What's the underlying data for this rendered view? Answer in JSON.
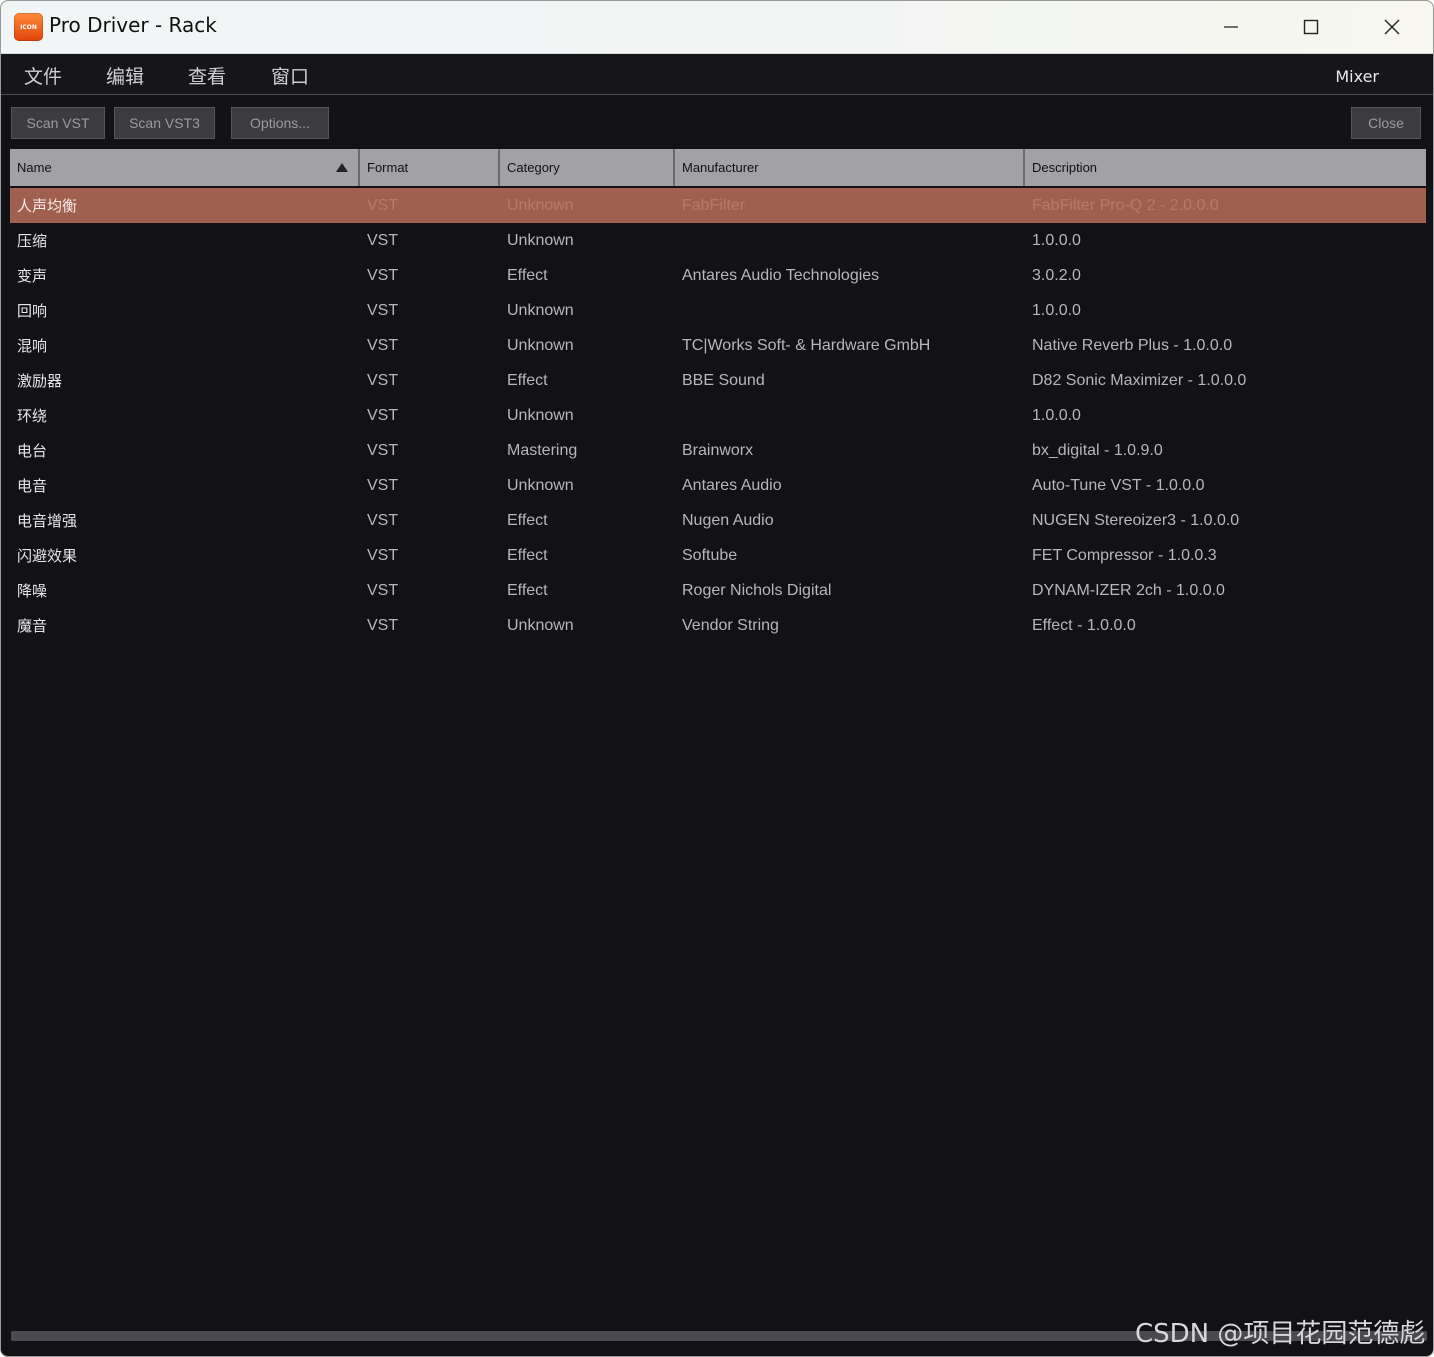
{
  "window": {
    "title": "Pro Driver - Rack",
    "app_icon_text": "ICON"
  },
  "menu": {
    "items": [
      "文件",
      "编辑",
      "查看",
      "窗口"
    ],
    "mixer": "Mixer"
  },
  "toolbar": {
    "scan_vst": "Scan VST",
    "scan_vst3": "Scan VST3",
    "options": "Options...",
    "close": "Close"
  },
  "table": {
    "headers": [
      "Name",
      "Format",
      "Category",
      "Manufacturer",
      "Description"
    ],
    "sort_column": "Name",
    "sort_direction": "ascending",
    "selected_row": 0,
    "rows": [
      [
        "人声均衡",
        "VST",
        "Unknown",
        "FabFilter",
        "FabFilter Pro-Q 2 - 2.0.0.0"
      ],
      [
        "压缩",
        "VST",
        "Unknown",
        "",
        "1.0.0.0"
      ],
      [
        "变声",
        "VST",
        "Effect",
        "Antares Audio Technologies",
        "3.0.2.0"
      ],
      [
        "回响",
        "VST",
        "Unknown",
        "",
        "1.0.0.0"
      ],
      [
        "混响",
        "VST",
        "Unknown",
        "TC|Works Soft- & Hardware GmbH",
        "Native Reverb Plus - 1.0.0.0"
      ],
      [
        "激励器",
        "VST",
        "Effect",
        "BBE Sound",
        "D82 Sonic Maximizer - 1.0.0.0"
      ],
      [
        "环绕",
        "VST",
        "Unknown",
        "",
        "1.0.0.0"
      ],
      [
        "电台",
        "VST",
        "Mastering",
        "Brainworx",
        "bx_digital - 1.0.9.0"
      ],
      [
        "电音",
        "VST",
        "Unknown",
        "Antares Audio",
        "Auto-Tune VST - 1.0.0.0"
      ],
      [
        "电音增强",
        "VST",
        "Effect",
        "Nugen Audio",
        "NUGEN Stereoizer3 - 1.0.0.0"
      ],
      [
        "闪避效果",
        "VST",
        "Effect",
        "Softube",
        "FET Compressor - 1.0.0.3"
      ],
      [
        "降噪",
        "VST",
        "Effect",
        "Roger Nichols Digital",
        "DYNAM-IZER 2ch - 1.0.0.0"
      ],
      [
        "魔音",
        "VST",
        "Unknown",
        "Vendor String",
        "Effect - 1.0.0.0"
      ]
    ]
  },
  "watermark": "CSDN @项目花园范德彪",
  "colors": {
    "selected_row": "#a1604f",
    "background": "#111116",
    "header": "#a2a2a6"
  }
}
